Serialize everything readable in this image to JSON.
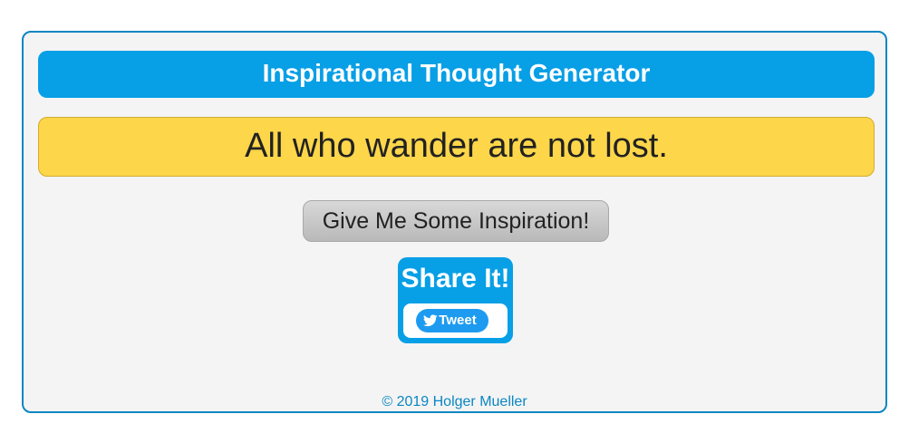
{
  "header": {
    "title": "Inspirational Thought Generator"
  },
  "quote": {
    "text": "All who wander are not lost."
  },
  "actions": {
    "inspire_label": "Give Me Some Inspiration!"
  },
  "share": {
    "title": "Share It!",
    "tweet_label": "Tweet",
    "tweet_icon": "twitter-bird-icon"
  },
  "footer": {
    "text": "© 2019 Holger Mueller"
  },
  "colors": {
    "accent": "#079fe6",
    "quote_bg": "#fdd64a",
    "border": "#0a86c2",
    "twitter": "#1d9bf0"
  }
}
